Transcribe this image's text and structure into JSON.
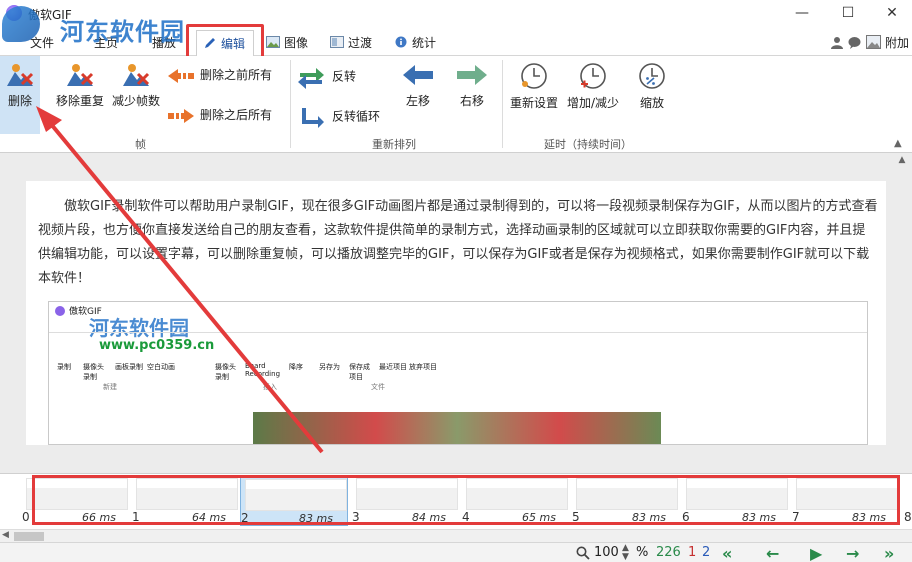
{
  "window": {
    "title": "傲软GIF",
    "minimize": "—",
    "maximize": "☐",
    "close": "✕"
  },
  "watermark": {
    "text": "河东软件园",
    "url": "www.pc0359.cn"
  },
  "tabs": [
    {
      "label": "文件"
    },
    {
      "label": "主页"
    },
    {
      "label": "播放"
    },
    {
      "label": "编辑"
    },
    {
      "label": "图像"
    },
    {
      "label": "过渡"
    },
    {
      "label": "统计"
    }
  ],
  "header_right": {
    "attach_label": "附加"
  },
  "ribbon": {
    "frames": {
      "delete": "删除",
      "remove_duplicates": "移除重复",
      "reduce_frames": "减少帧数",
      "delete_before": "删除之前所有",
      "delete_after": "删除之后所有",
      "group_label": "帧"
    },
    "reorder": {
      "reverse": "反转",
      "reverse_loop": "反转循环",
      "move_left": "左移",
      "move_right": "右移",
      "group_label": "重新排列"
    },
    "delay": {
      "reset": "重新设置",
      "increase_decrease": "增加/减少",
      "scale": "缩放",
      "group_label": "延时（持续时间）"
    }
  },
  "content": {
    "description": "傲软GIF录制软件可以帮助用户录制GIF，现在很多GIF动画图片都是通过录制得到的，可以将一段视频录制保存为GIF，从而以图片的方式查看视频片段，也方便你直接发送给自己的朋友查看，这款软件提供简单的录制方式，选择动画录制的区域就可以立即获取你需要的GIF内容，并且提供编辑功能，可以设置字幕，可以删除重复帧，可以播放调整完毕的GIF，可以保存为GIF或者是保存为视频格式，如果你需要制作GIF就可以下载本软件！",
    "inner": {
      "title": "傲软GIF",
      "tools": [
        "录制",
        "摄像头录制",
        "画板录制",
        "空白动画",
        "摄像头录制",
        "Board Recording",
        "降序",
        "另存为",
        "保存成项目",
        "最近项目",
        "放弃项目"
      ],
      "groups": [
        "新建",
        "插入",
        "文件"
      ],
      "watermark_text": "河东软件园",
      "watermark_url": "www.pc0359.cn"
    }
  },
  "thumbnails": [
    {
      "index": "0",
      "ms": "66 ms"
    },
    {
      "index": "1",
      "ms": "64 ms"
    },
    {
      "index": "2",
      "ms": "83 ms",
      "selected": true
    },
    {
      "index": "3",
      "ms": "84 ms"
    },
    {
      "index": "4",
      "ms": "65 ms"
    },
    {
      "index": "5",
      "ms": "83 ms"
    },
    {
      "index": "6",
      "ms": "83 ms"
    },
    {
      "index": "7",
      "ms": "83 ms"
    },
    {
      "index": "8",
      "ms": ""
    }
  ],
  "status": {
    "zoom": "100",
    "zoom_unit": "%",
    "total_frames": "226",
    "selected_count": "1",
    "current_frame": "2"
  },
  "colors": {
    "highlight_red": "#e33b3b",
    "accent_blue": "#1d6fc7",
    "nav_green": "#2a8a4a",
    "selected_bg": "#cde4f7"
  }
}
